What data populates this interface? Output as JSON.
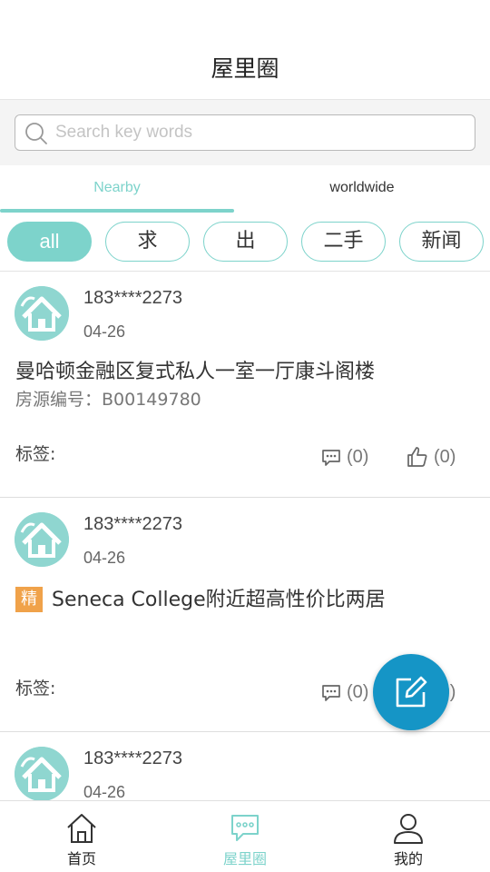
{
  "header": {
    "title": "屋里圈"
  },
  "search": {
    "placeholder": "Search key words"
  },
  "tabs": [
    {
      "label": "Nearby",
      "active": true
    },
    {
      "label": "worldwide",
      "active": false
    }
  ],
  "chips": [
    {
      "label": "all",
      "active": true
    },
    {
      "label": "求",
      "active": false
    },
    {
      "label": "出",
      "active": false
    },
    {
      "label": "二手",
      "active": false
    },
    {
      "label": "新闻",
      "active": false
    }
  ],
  "posts": [
    {
      "user": "183****2273",
      "date": "04-26",
      "title": "曼哈顿金融区复式私人一室一厅康斗阁楼",
      "subtitle": "房源编号：B00149780",
      "tags_label": "标签:",
      "comments": "(0)",
      "likes": "(0)"
    },
    {
      "user": "183****2273",
      "date": "04-26",
      "badge": "精",
      "title": "Seneca College附近超高性价比两居",
      "tags_label": "标签:",
      "comments": "(0)",
      "likes": "(0)"
    },
    {
      "user": "183****2273",
      "date": "04-26"
    }
  ],
  "bottom_nav": [
    {
      "label": "首页",
      "icon": "home-icon",
      "active": false
    },
    {
      "label": "屋里圈",
      "icon": "chat-icon",
      "active": true
    },
    {
      "label": "我的",
      "icon": "user-icon",
      "active": false
    }
  ],
  "colors": {
    "accent": "#7dd3cb",
    "fab": "#1595c6",
    "badge": "#f0a24a"
  }
}
